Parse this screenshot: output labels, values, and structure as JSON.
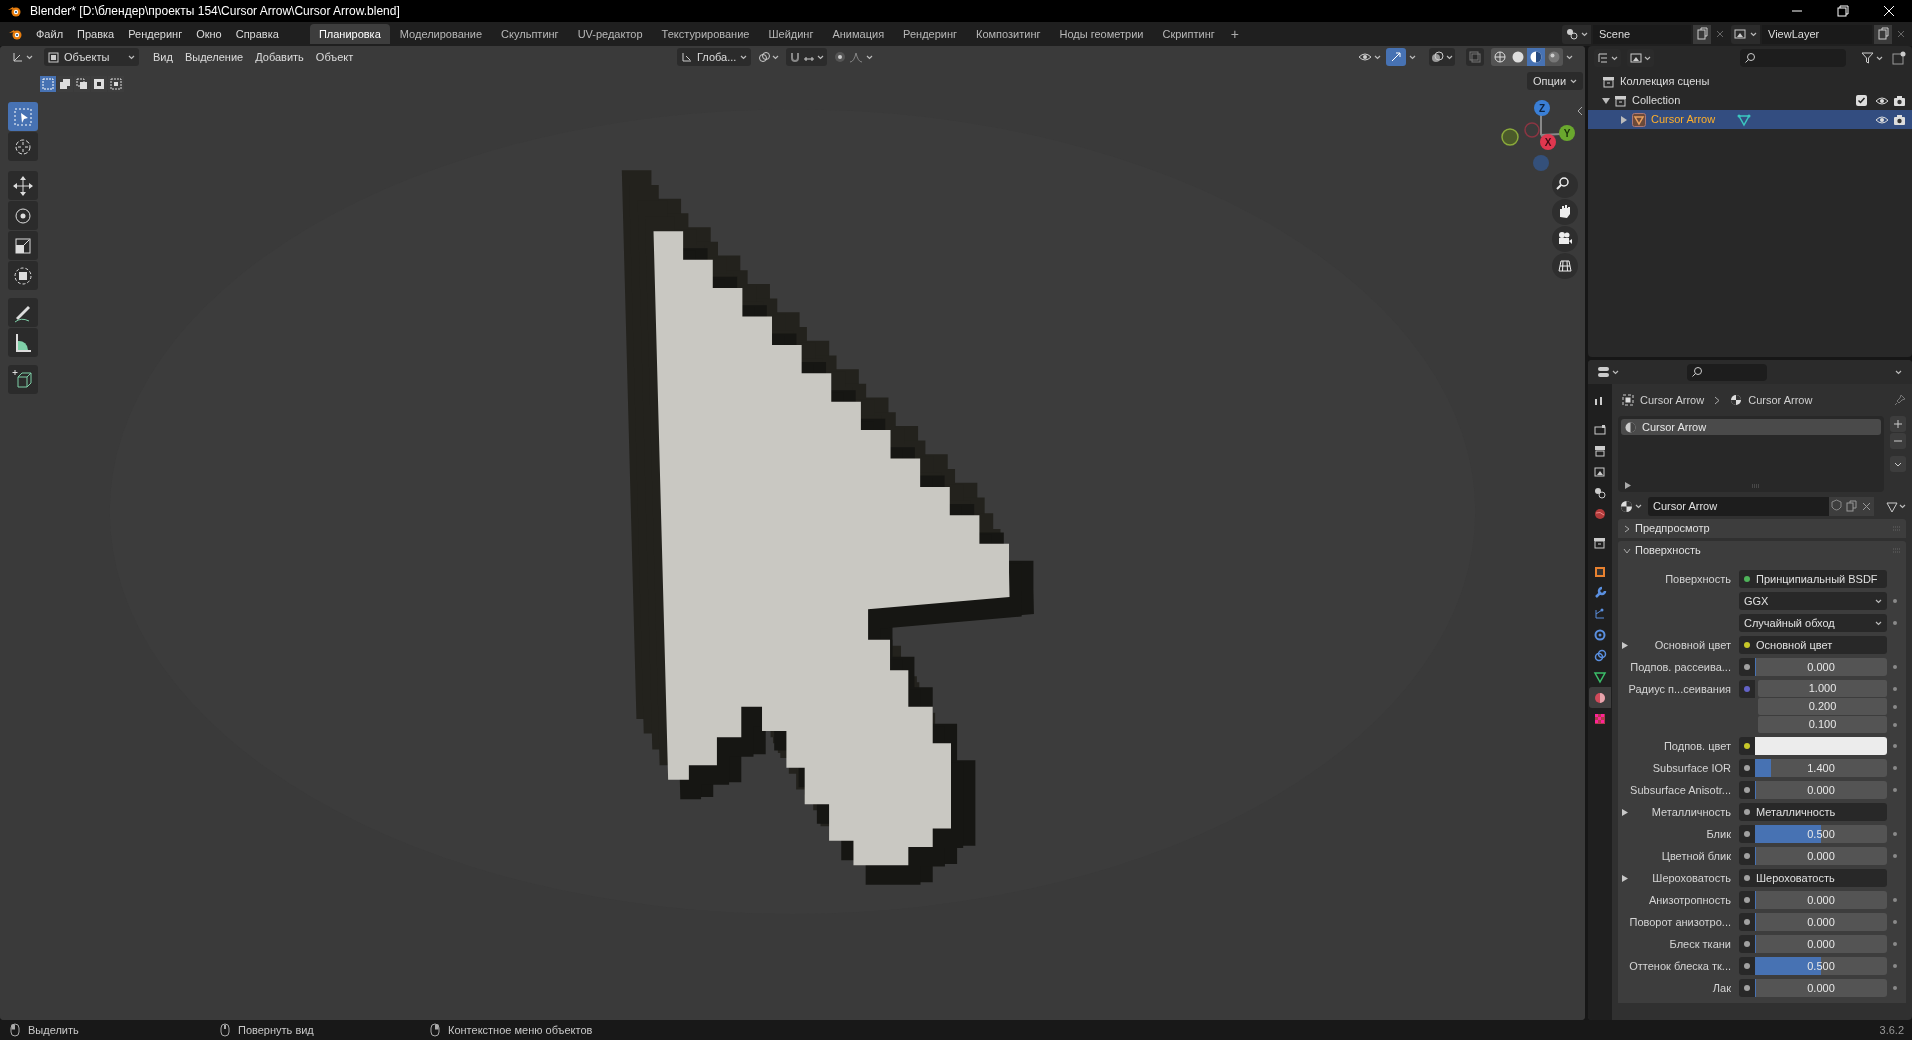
{
  "window": {
    "title": "Blender* [D:\\блендер\\проекты 154\\Cursor Arrow\\Cursor Arrow.blend]"
  },
  "menu": [
    "Файл",
    "Правка",
    "Рендеринг",
    "Окно",
    "Справка"
  ],
  "workspaces": [
    {
      "label": "Планировка",
      "selected": true
    },
    {
      "label": "Моделирование",
      "selected": false
    },
    {
      "label": "Скульптинг",
      "selected": false
    },
    {
      "label": "UV-редактор",
      "selected": false
    },
    {
      "label": "Текстурирование",
      "selected": false
    },
    {
      "label": "Шейдинг",
      "selected": false
    },
    {
      "label": "Анимация",
      "selected": false
    },
    {
      "label": "Рендеринг",
      "selected": false
    },
    {
      "label": "Композитинг",
      "selected": false
    },
    {
      "label": "Ноды геометрии",
      "selected": false
    },
    {
      "label": "Скриптинг",
      "selected": false
    }
  ],
  "add_workspace": "+",
  "scene": {
    "name": "Scene"
  },
  "view_layer": {
    "name": "ViewLayer"
  },
  "viewport": {
    "mode": "Объекты",
    "menus": [
      "Вид",
      "Выделение",
      "Добавить",
      "Объект"
    ],
    "orientation": "Глоба...",
    "options": "Опции",
    "select_modes": [
      {
        "selected": true
      },
      {
        "selected": false
      },
      {
        "selected": false
      },
      {
        "selected": false
      },
      {
        "selected": false
      }
    ],
    "gizmo_toggle": {
      "on": true
    },
    "snap": {
      "on": false
    },
    "proportional_edit": {
      "on": false
    },
    "shading": [
      {
        "selected": false
      },
      {
        "selected": false
      },
      {
        "selected": true
      },
      {
        "selected": false
      }
    ],
    "tools": [
      {
        "selected": true
      },
      {
        "selected": false
      },
      {
        "selected": false
      },
      {
        "selected": false
      },
      {
        "selected": false
      },
      {
        "selected": false
      },
      {
        "selected": false
      },
      {
        "selected": false
      },
      {
        "selected": false
      }
    ],
    "axes": [
      "Z",
      "X",
      "Y"
    ]
  },
  "outliner": {
    "tree": [
      {
        "label": "Коллекция сцены",
        "selected": false,
        "children": [
          {
            "label": "Collection",
            "selected": false,
            "expanded": true,
            "checked": true,
            "children": [
              {
                "label": "Cursor Arrow",
                "selected": true,
                "expanded": false
              }
            ]
          }
        ]
      }
    ]
  },
  "properties": {
    "tabs": [
      {
        "selected": false
      },
      {
        "selected": false
      },
      {
        "selected": false
      },
      {
        "selected": false
      },
      {
        "selected": false
      },
      {
        "selected": false
      },
      {
        "selected": false
      },
      {
        "selected": false
      },
      {
        "selected": false
      },
      {
        "selected": false
      },
      {
        "selected": false
      },
      {
        "selected": false
      },
      {
        "selected": false
      },
      {
        "selected": true
      },
      {
        "selected": false
      }
    ],
    "breadcrumb": [
      "Cursor Arrow",
      "Cursor Arrow"
    ],
    "slots": [
      {
        "label": "Cursor Arrow",
        "selected": true
      }
    ],
    "material_name": "Cursor Arrow",
    "panels": [
      {
        "label": "Предпросмотр",
        "expanded": false
      },
      {
        "label": "Поверхность",
        "expanded": true
      }
    ],
    "rows": [
      {
        "kind": "link",
        "label": "Поверхность",
        "value": "Принципиальный BSDF",
        "color": "#4fb35a",
        "expandable": false
      },
      {
        "kind": "dropdown",
        "value": "GGX"
      },
      {
        "kind": "dropdown",
        "value": "Случайный обход"
      },
      {
        "kind": "link",
        "label": "Основной цвет",
        "value": "Основной цвет",
        "color": "#c7c729",
        "expandable": true
      },
      {
        "kind": "slider",
        "label": "Подпов. рассеива...",
        "value": "0.000",
        "level": 0,
        "color": "#a1a1a1"
      },
      {
        "kind": "vector",
        "label": "Радиус п...сеивания",
        "values": [
          "1.000",
          "0.200",
          "0.100"
        ],
        "color": "#6363c7"
      },
      {
        "kind": "color",
        "label": "Подпов. цвет",
        "color": "#c7c729"
      },
      {
        "kind": "slider",
        "label": "Subsurface IOR",
        "value": "1.400",
        "level": 0.12,
        "color": "#a1a1a1"
      },
      {
        "kind": "slider",
        "label": "Subsurface Anisotr...",
        "value": "0.000",
        "level": 0,
        "color": "#a1a1a1"
      },
      {
        "kind": "link",
        "label": "Металличность",
        "value": "Металличность",
        "color": "#a1a1a1",
        "expandable": true
      },
      {
        "kind": "slider",
        "label": "Блик",
        "value": "0.500",
        "level": 0.5,
        "color": "#a1a1a1"
      },
      {
        "kind": "slider",
        "label": "Цветной блик",
        "value": "0.000",
        "level": 0,
        "color": "#a1a1a1"
      },
      {
        "kind": "link",
        "label": "Шероховатость",
        "value": "Шероховатость",
        "color": "#a1a1a1",
        "expandable": true
      },
      {
        "kind": "slider",
        "label": "Анизотропность",
        "value": "0.000",
        "level": 0,
        "color": "#a1a1a1"
      },
      {
        "kind": "slider",
        "label": "Поворот анизотро...",
        "value": "0.000",
        "level": 0,
        "color": "#a1a1a1"
      },
      {
        "kind": "slider",
        "label": "Блеск ткани",
        "value": "0.000",
        "level": 0,
        "color": "#a1a1a1"
      },
      {
        "kind": "slider",
        "label": "Оттенок блеска тк...",
        "value": "0.500",
        "level": 0.5,
        "color": "#a1a1a1"
      },
      {
        "kind": "slider",
        "label": "Лак",
        "value": "0.000",
        "level": 0,
        "color": "#a1a1a1"
      }
    ]
  },
  "status_bar": {
    "hints": [
      "Выделить",
      "Повернуть вид",
      "Контекстное меню объектов"
    ],
    "version": "3.6.2"
  }
}
